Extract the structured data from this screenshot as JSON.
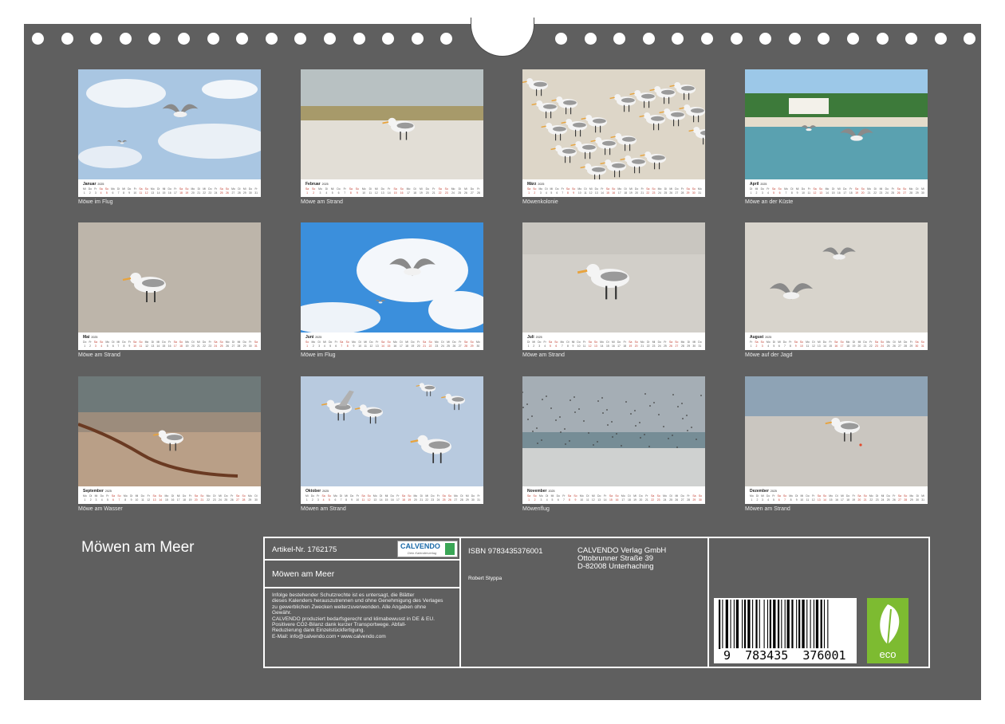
{
  "cover": {
    "title": "Möwen am Meer"
  },
  "months": [
    {
      "name": "Januar",
      "year": "2025",
      "caption": "Möwe im Flug",
      "days": 31,
      "start": 2,
      "scene": "sky-cloud"
    },
    {
      "name": "Februar",
      "year": "2025",
      "caption": "Möwe am Strand",
      "days": 28,
      "start": 5,
      "scene": "beach-wave"
    },
    {
      "name": "März",
      "year": "2025",
      "caption": "Möwenkolonie",
      "days": 31,
      "start": 5,
      "scene": "colony"
    },
    {
      "name": "April",
      "year": "2025",
      "caption": "Möwe an der Küste",
      "days": 30,
      "start": 1,
      "scene": "coast"
    },
    {
      "name": "Mai",
      "year": "2025",
      "caption": "Möwe am Strand",
      "days": 31,
      "start": 3,
      "scene": "pebble"
    },
    {
      "name": "Juni",
      "year": "2025",
      "caption": "Möwe im Flug",
      "days": 30,
      "start": 6,
      "scene": "blue-sky"
    },
    {
      "name": "Juli",
      "year": "2025",
      "caption": "Möwe am Strand",
      "days": 31,
      "start": 1,
      "scene": "sand-gull"
    },
    {
      "name": "August",
      "year": "2025",
      "caption": "Möwe auf der Jagd",
      "days": 31,
      "start": 4,
      "scene": "sand-fly"
    },
    {
      "name": "September",
      "year": "2025",
      "caption": "Möwe am Wasser",
      "days": 30,
      "start": 0,
      "scene": "sunset-beach"
    },
    {
      "name": "Oktober",
      "year": "2025",
      "caption": "Möwen am Strand",
      "days": 31,
      "start": 2,
      "scene": "white-sand"
    },
    {
      "name": "November",
      "year": "2025",
      "caption": "Möwenflug",
      "days": 30,
      "start": 5,
      "scene": "flock"
    },
    {
      "name": "Dezember",
      "year": "2025",
      "caption": "Möwen am Strand",
      "days": 31,
      "start": 0,
      "scene": "grey-beach"
    }
  ],
  "info": {
    "article": "Artikel-Nr. 1762175",
    "title": "Möwen am Meer",
    "legal": [
      "Infolge bestehender Schutzrechte ist es untersagt, die Blätter",
      "dieses Kalenders herauszutrennen und ohne Genehmigung des Verlages",
      "zu gewerblichen Zwecken weiterzuverwenden. Alle Angaben ohne",
      "Gewähr.",
      "CALVENDO produziert bedarfsgerecht und klimabewusst in DE & EU.",
      "Positivere CO2-Bilanz dank kurzer Transportwege. Abfall-",
      "Reduzierung dank Einzelstückfertigung.",
      "E-Mail: info@calvendo.com • www.calvendo.com"
    ],
    "isbn": "ISBN 9783435376001",
    "author": "Robert Styppa",
    "publisher": [
      "CALVENDO Verlag GmbH",
      "Ottobrunner Straße 39",
      "D-82008 Unterhaching"
    ],
    "barcode_digits": "9  783435  376001",
    "logo_text": "CALVENDO",
    "logo_sub": "Dein Kalenderverlag",
    "eco_label": "eco"
  }
}
